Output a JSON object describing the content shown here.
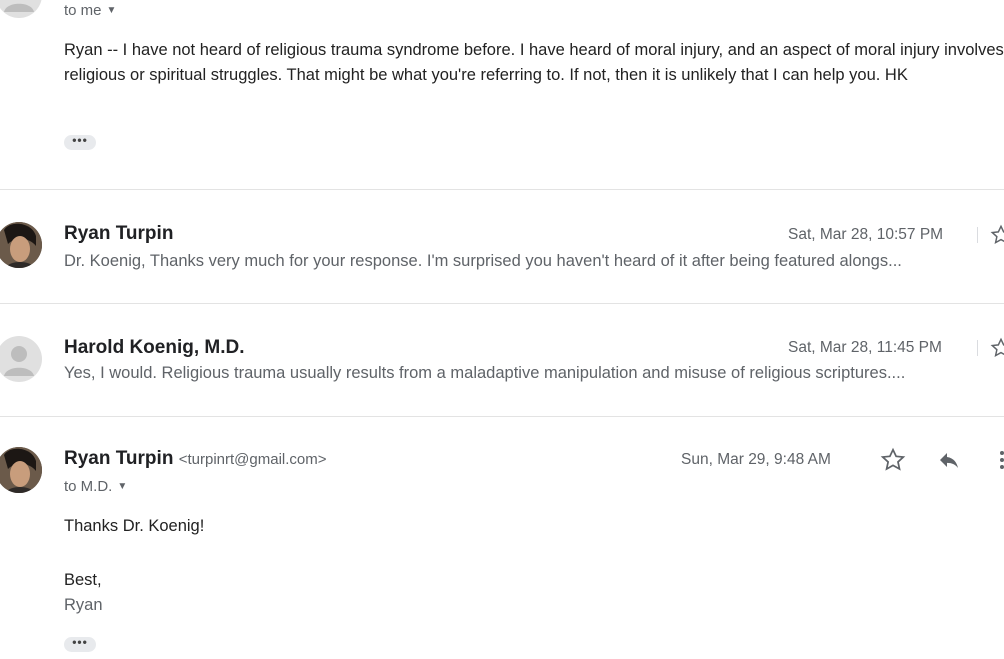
{
  "messages": [
    {
      "to_line": "to me",
      "body": "Ryan -- I have not heard of religious trauma syndrome before. I have heard of moral injury, and an aspect of moral injury involves religious or spiritual struggles. That might be what you're referring to. If not, then it is unlikely that I can help you. HK",
      "ellipsis": "•••"
    },
    {
      "sender": "Ryan Turpin",
      "date": "Sat, Mar 28, 10:57 PM",
      "snippet": "Dr. Koenig, Thanks very much for your response. I'm surprised you haven't heard of it after being featured alongs..."
    },
    {
      "sender": "Harold Koenig, M.D.",
      "date": "Sat, Mar 28, 11:45 PM",
      "snippet": "Yes, I would. Religious trauma usually results from a maladaptive manipulation and misuse of religious scriptures...."
    },
    {
      "sender": "Ryan Turpin",
      "email": "<turpinrt@gmail.com>",
      "date": "Sun, Mar 29, 9:48 AM",
      "to_line": "to M.D.",
      "body_line1": "Thanks Dr. Koenig!",
      "body_line2": "Best,",
      "body_line3": "Ryan",
      "ellipsis": "•••"
    }
  ]
}
